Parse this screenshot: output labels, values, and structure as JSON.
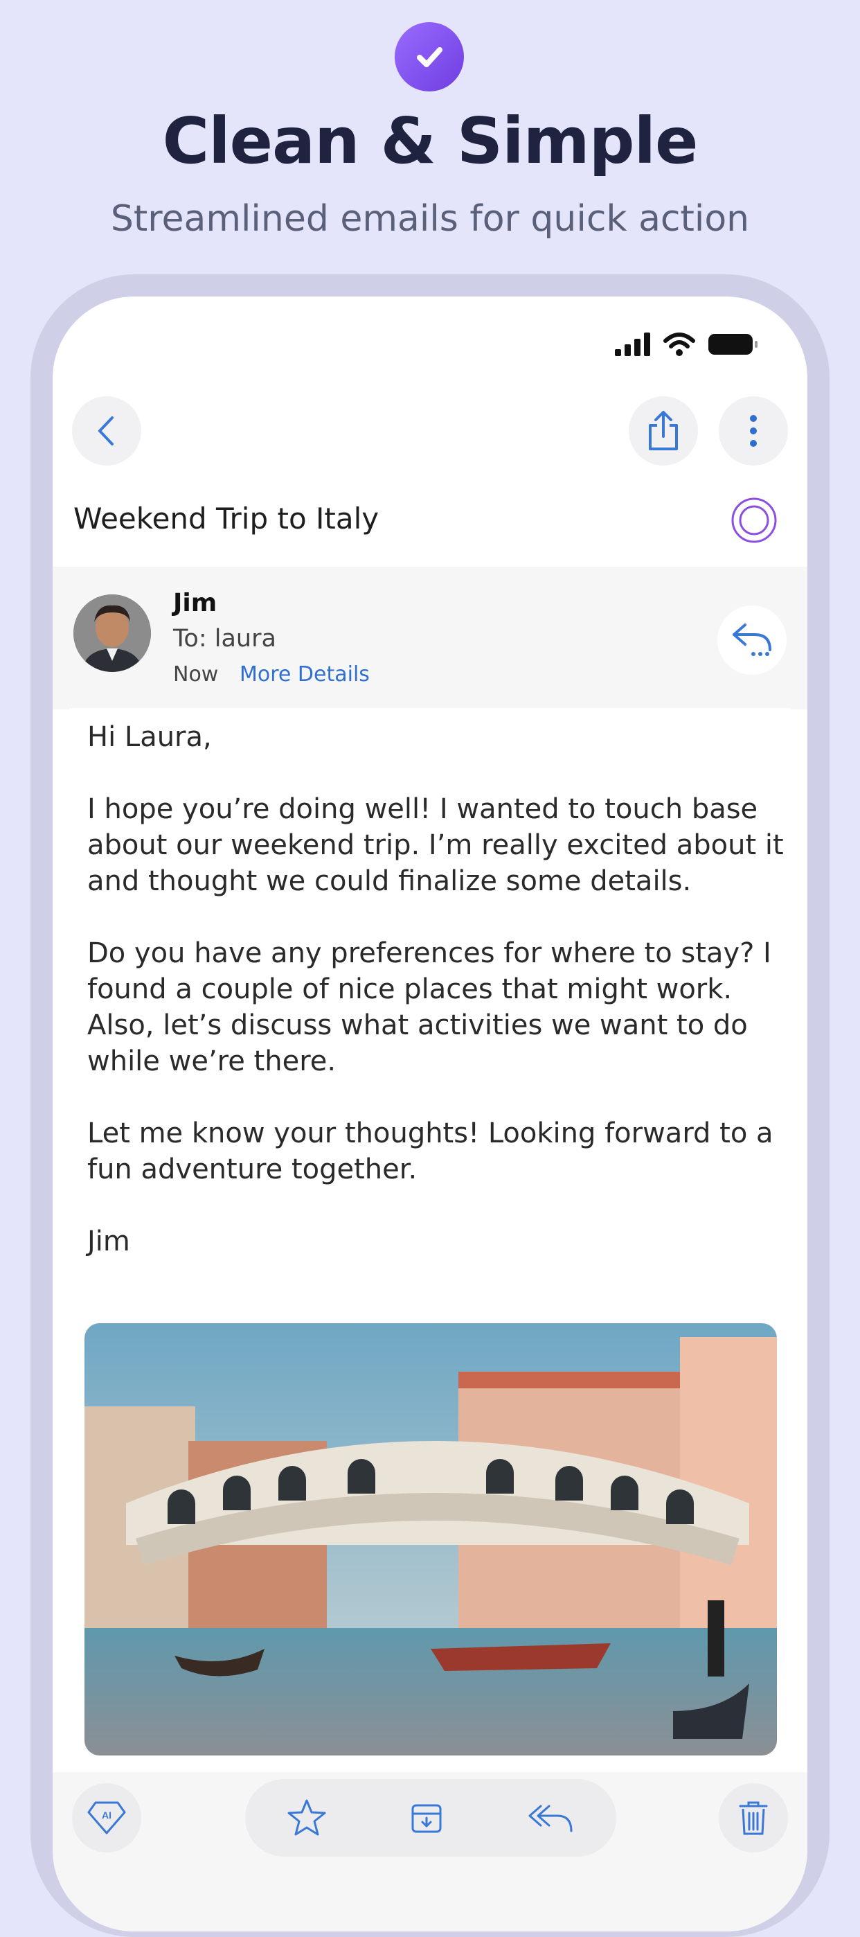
{
  "promo": {
    "title": "Clean & Simple",
    "subtitle": "Streamlined emails for quick action",
    "badge_icon": "checkmark-icon"
  },
  "toolbar": {
    "back_icon": "chevron-left-icon",
    "share_icon": "share-icon",
    "more_icon": "more-vertical-icon"
  },
  "email": {
    "subject": "Weekend Trip to Italy",
    "sender": {
      "name": "Jim",
      "to": "To: laura",
      "time": "Now",
      "more_details": "More Details"
    },
    "body": [
      "Hi Laura,",
      "I hope you’re doing well! I wanted to touch base about our weekend trip. I’m really excited about it and thought we could finalize some details.",
      "Do you have any preferences for where to stay? I found a couple of nice places that might work. Also, let’s discuss what activities we want to do while we’re there.",
      "Let me know your thoughts! Looking forward to a fun adventure together.",
      "Jim"
    ]
  },
  "bottom_bar": {
    "items": [
      "ai-gem-icon",
      "star-icon",
      "archive-icon",
      "reply-all-icon",
      "trash-icon"
    ]
  },
  "colors": {
    "background": "#e4e4fb",
    "accent_purple": "#7b4cf0",
    "link_blue": "#2f6fd0",
    "icon_blue": "#3a78d6"
  }
}
